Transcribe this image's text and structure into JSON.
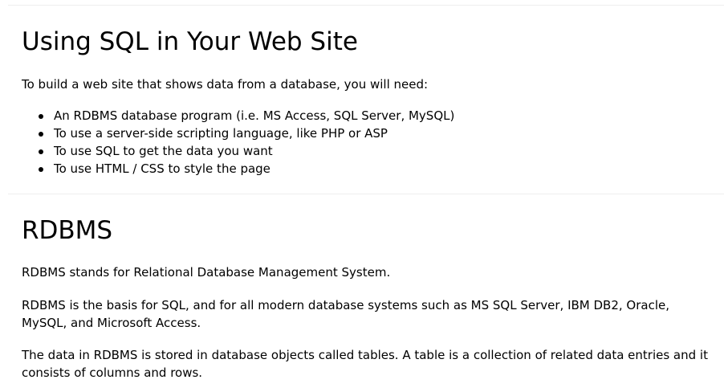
{
  "section_sql": {
    "title": "Using SQL in Your Web Site",
    "intro": "To build a web site that shows data from a database, you will need:",
    "requirements": [
      "An RDBMS database program (i.e. MS Access, SQL Server, MySQL)",
      "To use a server-side scripting language, like PHP or ASP",
      "To use SQL to get the data you want",
      "To use HTML / CSS to style the page"
    ]
  },
  "section_rdbms": {
    "title": "RDBMS",
    "paragraphs": [
      "RDBMS stands for Relational Database Management System.",
      "RDBMS is the basis for SQL, and for all modern database systems such as MS SQL Server, IBM DB2, Oracle, MySQL, and Microsoft Access.",
      "The data in RDBMS is stored in database objects called tables. A table is a collection of related data entries and it consists of columns and rows."
    ]
  },
  "colors": {
    "text": "#000000",
    "divider": "#eeeeee",
    "background": "#ffffff"
  }
}
